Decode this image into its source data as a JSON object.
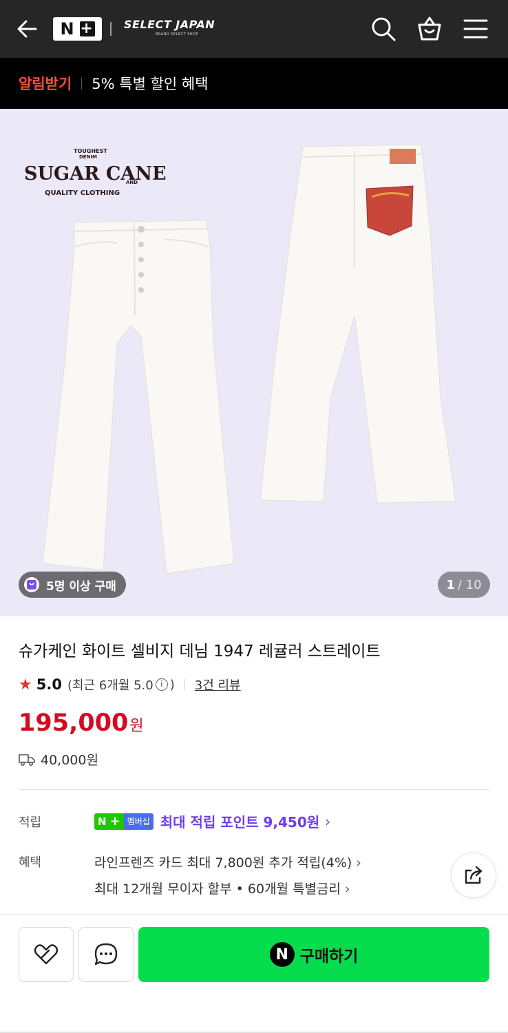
{
  "header": {
    "logo": "N+",
    "shop_name": "SELECT JAPAN",
    "shop_sub": "BRAND SELECT SHOP",
    "icons": [
      "back-arrow-icon",
      "search-icon",
      "shopping-bag-icon",
      "menu-icon"
    ]
  },
  "alert": {
    "label": "알림받기",
    "text": "5% 특별 할인 혜택"
  },
  "gallery": {
    "brand": {
      "top1": "TOUGHEST",
      "top2": "DENIM",
      "name": "SUGAR CANE & CO.",
      "and": "AND",
      "tagline": "QUALITY CLOTHING"
    },
    "badge": "5명 이상 구매",
    "current": "1",
    "total": "/ 10"
  },
  "product": {
    "title": "슈가케인 화이트 셀비지 데님 1947 레귤러 스트레이트",
    "score": "5.0",
    "recent": "(최근 6개월 5.0",
    "recent_close": ")",
    "reviews": "3건 리뷰",
    "price": "195,000",
    "currency": "원",
    "shipping": "40,000원"
  },
  "benefits": {
    "points_label": "적립",
    "member_n": "N",
    "member_plus": "+",
    "member_text": "멤버십",
    "points_text": "최대 적립 포인트 9,450원",
    "benefit_label": "혜택",
    "line1": "라인프렌즈 카드 최대 7,800원 추가 적립(4%)",
    "line2": "최대 12개월 무이자 할부 • 60개월 특별금리"
  },
  "actions": {
    "buy_label": "구매하기",
    "npay": "N"
  },
  "colors": {
    "header_bg": "#262626",
    "alert_label": "#ff4d3d",
    "price": "#d30c22",
    "points": "#6c3df0",
    "buy_button": "#06dd4c",
    "hero_bg": "#ebe8f8"
  }
}
